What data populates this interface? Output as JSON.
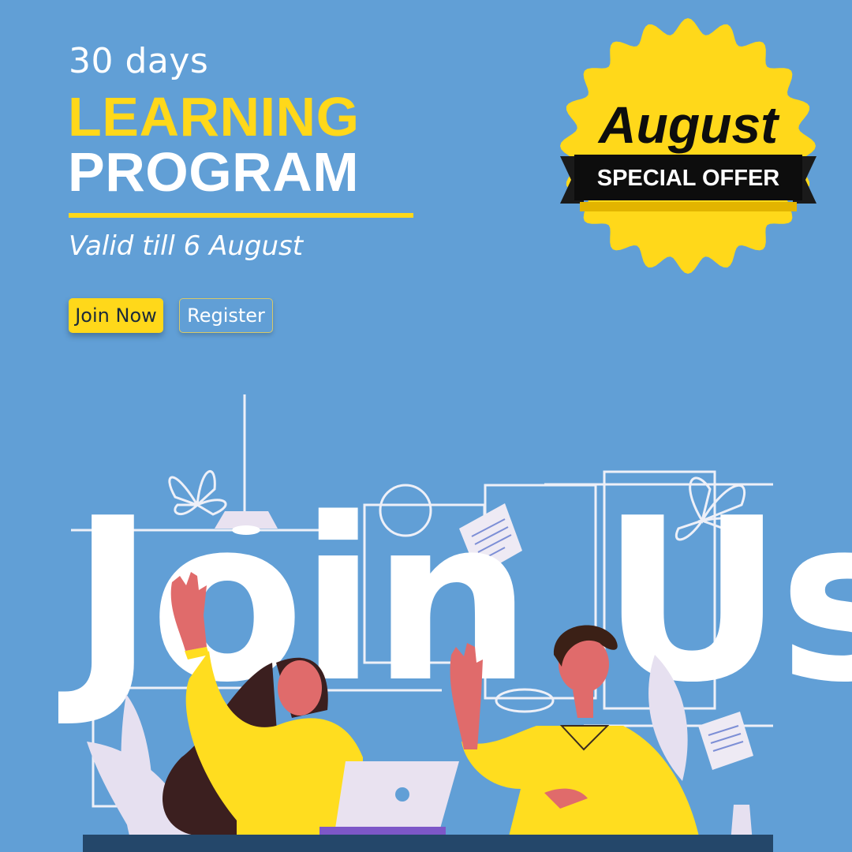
{
  "promo": {
    "subtitle": "30 days",
    "title_line1": "LEARNING",
    "title_line2": "PROGRAM",
    "validity": "Valid till 6 August"
  },
  "buttons": {
    "join_label": "Join Now",
    "register_label": "Register"
  },
  "badge": {
    "month": "August",
    "ribbon_text": "SPECIAL OFFER"
  },
  "illustration": {
    "headline": "Join Us"
  },
  "colors": {
    "background": "#619fd6",
    "accent_yellow": "#ffd81a",
    "ribbon_black": "#0d0d0d",
    "text_white": "#ffffff"
  }
}
